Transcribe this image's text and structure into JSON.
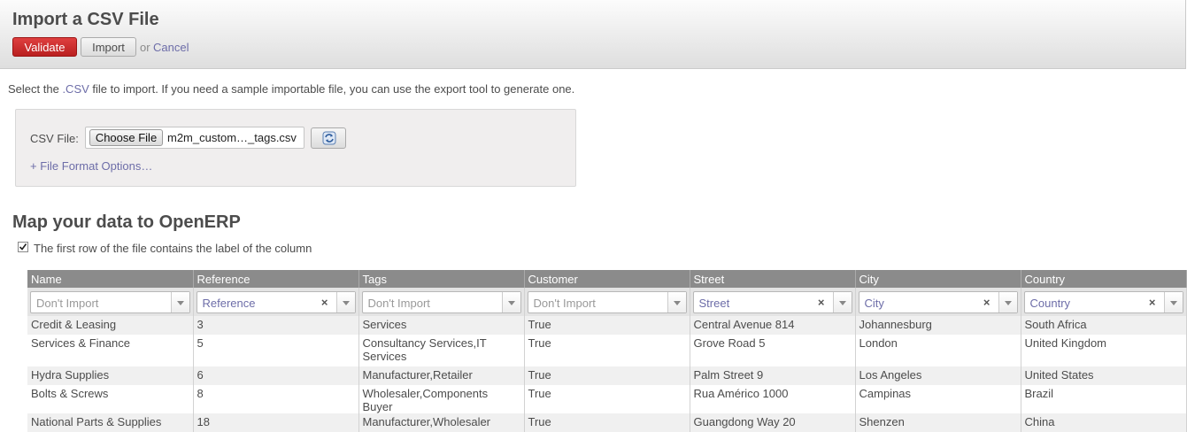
{
  "header": {
    "title": "Import a CSV File",
    "validate_label": "Validate",
    "import_label": "Import",
    "or_text": "or",
    "cancel_label": "Cancel"
  },
  "intro": {
    "before": "Select the ",
    "csv_link": ".CSV",
    "after": " file to import. If you need a sample importable file, you can use the export tool to generate one."
  },
  "file_box": {
    "label": "CSV File:",
    "choose_label": "Choose File",
    "file_name": "m2m_custom…_tags.csv",
    "reload_icon": "reload-icon",
    "format_options_label": "+ File Format Options…"
  },
  "mapping": {
    "title": "Map your data to OpenERP",
    "first_row_label": "The first row of the file contains the label of the column",
    "first_row_checked": true,
    "columns": [
      "Name",
      "Reference",
      "Tags",
      "Customer",
      "Street",
      "City",
      "Country"
    ],
    "selectors": [
      {
        "value": "Don't Import",
        "set": false
      },
      {
        "value": "Reference",
        "set": true
      },
      {
        "value": "Don't Import",
        "set": false
      },
      {
        "value": "Don't Import",
        "set": false
      },
      {
        "value": "Street",
        "set": true
      },
      {
        "value": "City",
        "set": true
      },
      {
        "value": "Country",
        "set": true
      }
    ],
    "rows": [
      [
        "Credit & Leasing",
        "3",
        "Services",
        "True",
        "Central Avenue 814",
        "Johannesburg",
        "South Africa"
      ],
      [
        "Services & Finance",
        "5",
        "Consultancy Services,IT Services",
        "True",
        "Grove Road 5",
        "London",
        "United Kingdom"
      ],
      [
        "Hydra Supplies",
        "6",
        "Manufacturer,Retailer",
        "True",
        "Palm Street 9",
        "Los Angeles",
        "United States"
      ],
      [
        "Bolts & Screws",
        "8",
        "Wholesaler,Components Buyer",
        "True",
        "Rua Américo 1000",
        "Campinas",
        "Brazil"
      ],
      [
        "National Parts & Supplies",
        "18",
        "Manufacturer,Wholesaler",
        "True",
        "Guangdong Way 20",
        "Shenzen",
        "China"
      ]
    ]
  }
}
